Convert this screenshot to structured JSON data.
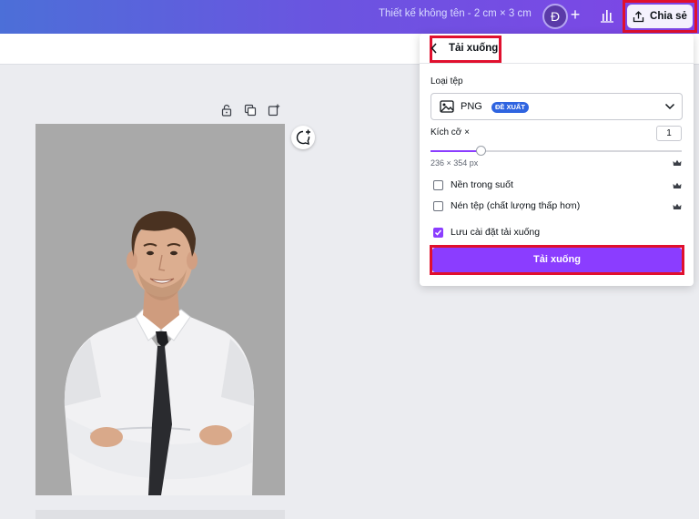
{
  "header": {
    "doc_title": "Thiết kế không tên - 2 cm × 3 cm",
    "avatar_initial": "Đ",
    "plus": "+",
    "share_label": "Chia sẻ"
  },
  "download_panel": {
    "title": "Tải xuống",
    "file_type_label": "Loại tệp",
    "file_type_value": "PNG",
    "recommended_badge": "ĐỀ XUẤT",
    "size_label": "Kích cỡ ×",
    "size_value": "1",
    "size_fraction": 0.2,
    "pixel_dims": "236 × 354 px",
    "transparent_bg_label": "Nền trong suốt",
    "compress_label": "Nén tệp (chất lượng thấp hơn)",
    "save_settings_label": "Lưu cài đặt tải xuống",
    "download_button": "Tải xuống"
  },
  "colors": {
    "accent": "#8b3dff",
    "highlight": "#e0102e",
    "badge": "#2f64e0"
  },
  "icons": [
    "lock-icon",
    "duplicate-icon",
    "add-page-icon",
    "comment-add-icon",
    "image-icon",
    "chevron-down-icon",
    "back-chevron-icon",
    "crown-icon",
    "share-upload-icon",
    "stats-icon"
  ]
}
